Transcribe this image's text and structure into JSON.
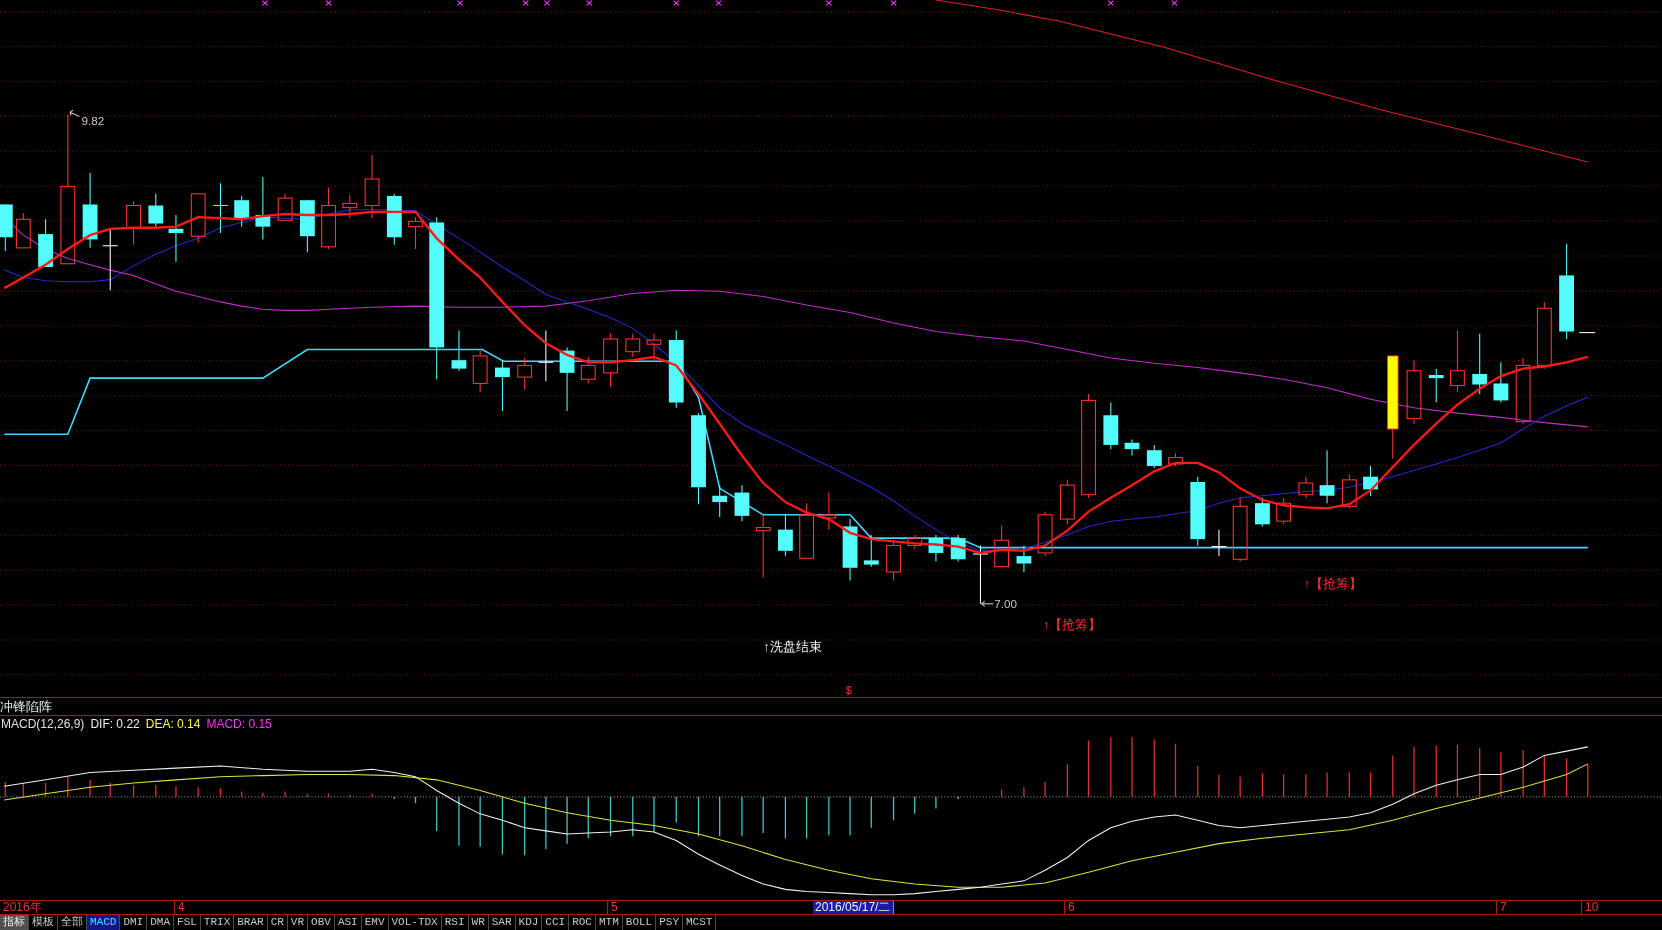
{
  "main_chart": {
    "high_label": "9.82",
    "low_label": "7.00",
    "signals": [
      {
        "text": "↑洗盘结束",
        "kind": "wash"
      },
      {
        "text": "↑【抢筹】",
        "kind": "grab"
      },
      {
        "text": "↑【抢筹】",
        "kind": "grab"
      }
    ],
    "marker": "$"
  },
  "indicator_panel": {
    "title": "冲锋陷阵"
  },
  "macd": {
    "name": "MACD(12,26,9)",
    "legend": [
      {
        "label": "DIF: 0.22",
        "color": "#f0f0f0"
      },
      {
        "label": "DEA: 0.14",
        "color": "#ffff40"
      },
      {
        "label": "MACD: 0.15",
        "color": "#ff30ff"
      }
    ]
  },
  "time_axis": {
    "labels": [
      {
        "text": "2016年",
        "kind": "tick"
      },
      {
        "text": "4",
        "kind": "tick"
      },
      {
        "text": "5",
        "kind": "tick"
      },
      {
        "text": "2016/05/17/二",
        "kind": "cursor"
      },
      {
        "text": "6",
        "kind": "tick"
      },
      {
        "text": "7",
        "kind": "tick"
      },
      {
        "text": "10",
        "kind": "tick"
      }
    ]
  },
  "mode_tabs": [
    {
      "label": "指标",
      "selected": true
    },
    {
      "label": "模板",
      "selected": false
    },
    {
      "label": "全部",
      "selected": false
    }
  ],
  "indicator_tabs": [
    {
      "label": "MACD",
      "selected": true
    },
    {
      "label": "DMI",
      "selected": false
    },
    {
      "label": "DMA",
      "selected": false
    },
    {
      "label": "FSL",
      "selected": false
    },
    {
      "label": "TRIX",
      "selected": false
    },
    {
      "label": "BRAR",
      "selected": false
    },
    {
      "label": "CR",
      "selected": false
    },
    {
      "label": "VR",
      "selected": false
    },
    {
      "label": "OBV",
      "selected": false
    },
    {
      "label": "ASI",
      "selected": false
    },
    {
      "label": "EMV",
      "selected": false
    },
    {
      "label": "VOL-TDX",
      "selected": false
    },
    {
      "label": "RSI",
      "selected": false
    },
    {
      "label": "WR",
      "selected": false
    },
    {
      "label": "SAR",
      "selected": false
    },
    {
      "label": "KDJ",
      "selected": false
    },
    {
      "label": "CCI",
      "selected": false
    },
    {
      "label": "ROC",
      "selected": false
    },
    {
      "label": "MTM",
      "selected": false
    },
    {
      "label": "BOLL",
      "selected": false
    },
    {
      "label": "PSY",
      "selected": false
    },
    {
      "label": "MCST",
      "selected": false
    }
  ]
}
